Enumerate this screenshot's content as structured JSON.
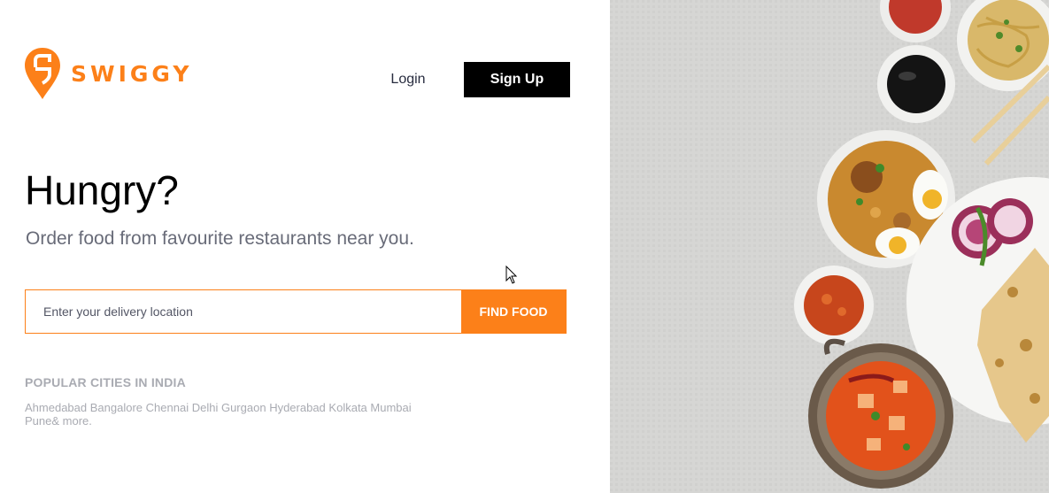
{
  "brand": {
    "name": "SWIGGY",
    "color": "#fc8019"
  },
  "nav": {
    "login_label": "Login",
    "signup_label": "Sign Up"
  },
  "hero": {
    "headline": "Hungry?",
    "subhead": "Order food from favourite restaurants near you."
  },
  "search": {
    "placeholder": "Enter your delivery location",
    "value": "",
    "button_label": "FIND FOOD"
  },
  "popular": {
    "title": "POPULAR CITIES IN INDIA",
    "cities": [
      "Ahmedabad",
      "Bangalore",
      "Chennai",
      "Delhi",
      "Gurgaon",
      "Hyderabad",
      "Kolkata",
      "Mumbai",
      "Pune"
    ],
    "more": "& more."
  },
  "icons": {
    "logo": "swiggy-logo-icon",
    "cursor": "mouse-cursor-icon"
  }
}
